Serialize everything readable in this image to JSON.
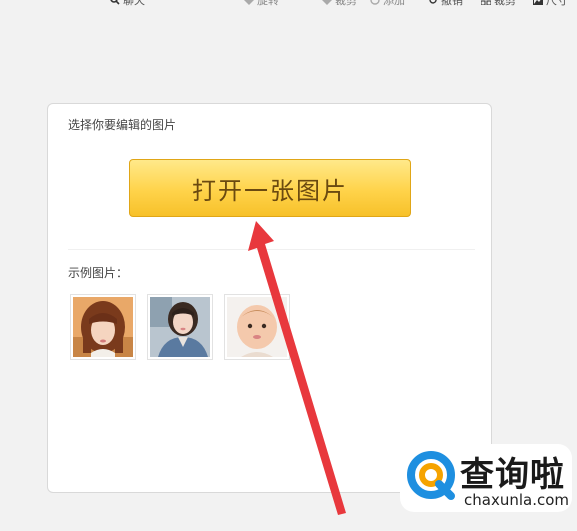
{
  "toolbar": {
    "items": [
      {
        "icon": "search-icon",
        "label": "聊天"
      },
      {
        "icon": "diamond-icon",
        "label": "旋转"
      },
      {
        "icon": "diamond-icon",
        "label": "裁剪"
      },
      {
        "icon": "circle-icon",
        "label": "添加"
      },
      {
        "icon": "history-icon",
        "label": "撤销"
      },
      {
        "icon": "grid-icon",
        "label": "裁剪"
      },
      {
        "icon": "image-icon",
        "label": "尺寸"
      }
    ]
  },
  "panel": {
    "title": "选择你要编辑的图片",
    "open_button": "打开一张图片",
    "samples_label": "示例图片："
  },
  "samples": [
    {
      "icon": "portrait-woman-bangs"
    },
    {
      "icon": "portrait-woman-denim"
    },
    {
      "icon": "portrait-baby"
    }
  ],
  "watermark": {
    "text": "查询啦",
    "url": "chaxunla.com"
  },
  "colors": {
    "button_top": "#ffe98a",
    "button_bottom": "#f7c12a",
    "arrow": "#e8383d",
    "watermark_blue": "#1e8fe0",
    "watermark_orange": "#f5a300"
  }
}
